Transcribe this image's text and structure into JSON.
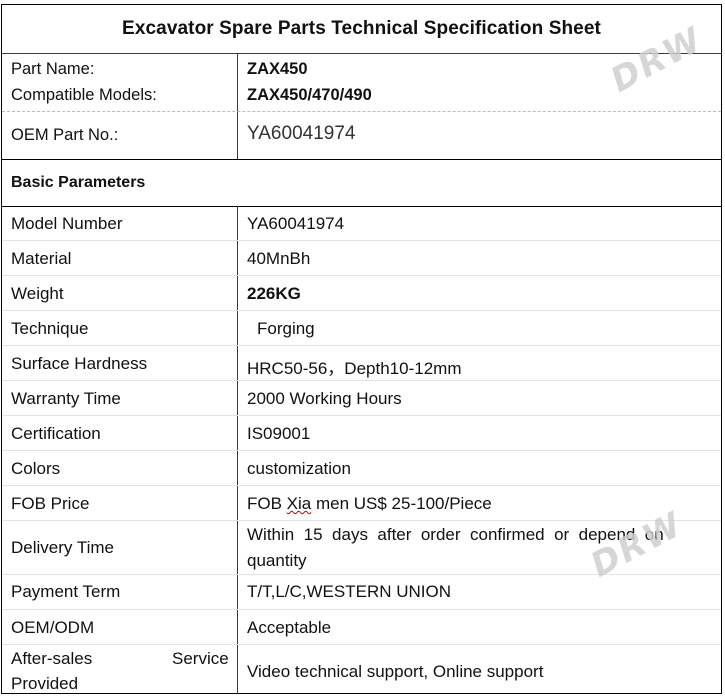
{
  "title": "Excavator Spare Parts Technical Specification Sheet",
  "header": {
    "part_name_label": "Part Name:",
    "part_name_value": "ZAX450",
    "models_label": "Compatible Models:",
    "models_value": "ZAX450/470/490",
    "oem_label": "OEM Part No.:",
    "oem_value": "YA60041974"
  },
  "section_title": "Basic Parameters",
  "rows": [
    {
      "label": "Model Number",
      "value": "YA60041974"
    },
    {
      "label": "Material",
      "value": "40MnBh"
    },
    {
      "label": "Weight",
      "value": "226KG"
    },
    {
      "label": "Technique",
      "value": "Forging"
    },
    {
      "label": "Surface Hardness",
      "value": "HRC50-56，Depth10-12mm"
    },
    {
      "label": "Warranty Time",
      "value": "2000 Working Hours"
    },
    {
      "label": "Certification",
      "value": "IS09001"
    },
    {
      "label": "Colors",
      "value": "customization"
    },
    {
      "label": "FOB Price",
      "value_pre": "FOB ",
      "value_mark": "Xia",
      "value_post": " men US$ 25-100/Piece"
    },
    {
      "label": "Delivery Time",
      "value_line1": "Within  15  days  after  order  confirmed  or  depend  on",
      "value_line2": "quantity"
    },
    {
      "label": "Payment Term",
      "value": "T/T,L/C,WESTERN UNION"
    },
    {
      "label": "OEM/ODM",
      "value": "Acceptable"
    },
    {
      "label_left": "After-sales",
      "label_right": "Service",
      "label_line2": "Provided",
      "value": "Video technical support, Online support"
    }
  ],
  "watermark": "DRW"
}
